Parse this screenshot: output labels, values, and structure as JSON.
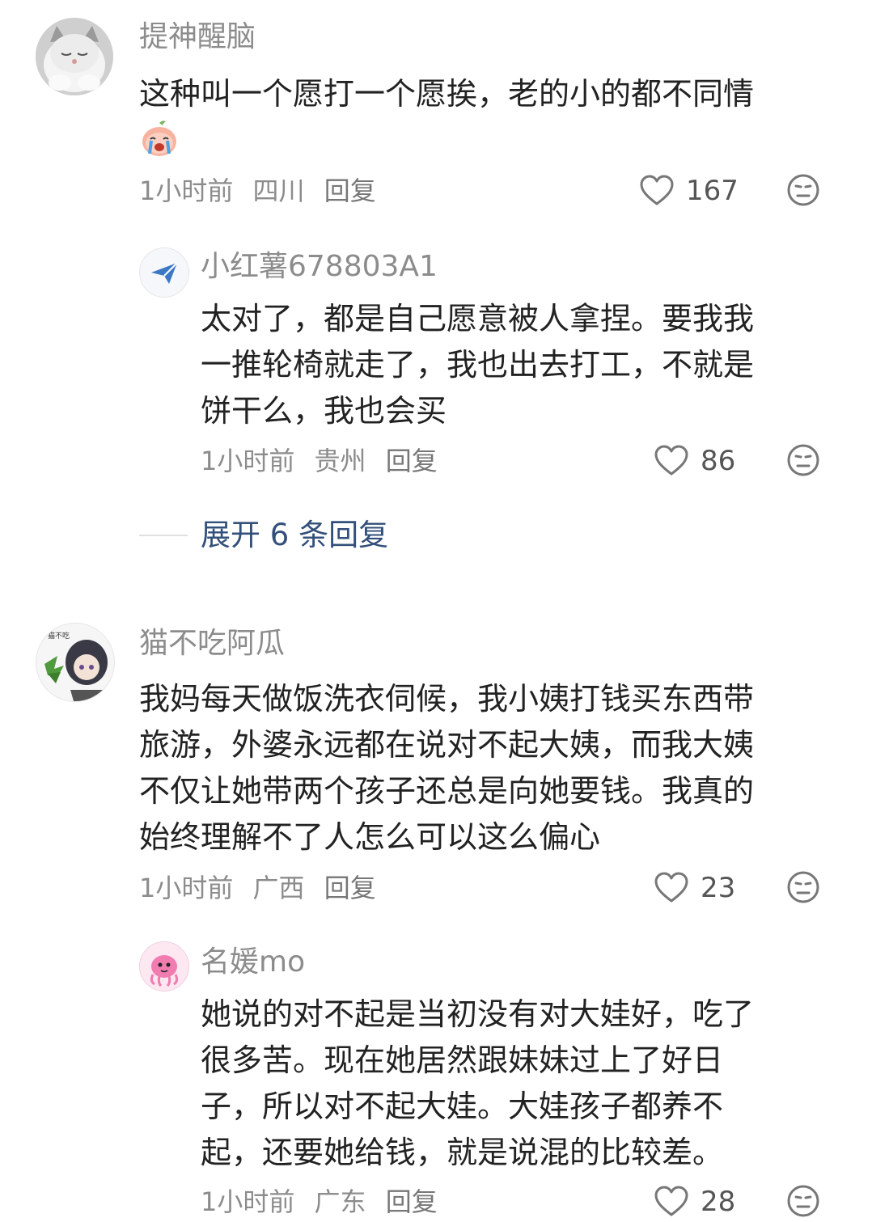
{
  "comments": [
    {
      "username": "提神醒脑",
      "lines": [
        "这种叫一个愿打一个愿挨，老的小的都不同情"
      ],
      "time": "1小时前",
      "region": "四川",
      "reply_label": "回复",
      "likes": "167",
      "emoji": "crying-peach-emoji"
    },
    {
      "username": "小红薯678803A1",
      "lines": [
        "太对了，都是自己愿意被人拿捏。要我我",
        "一推轮椅就走了，我也出去打工，不就是",
        "饼干么，我也会买"
      ],
      "time": "1小时前",
      "region": "贵州",
      "reply_label": "回复",
      "likes": "86"
    },
    {
      "username": "猫不吃阿瓜",
      "lines": [
        "我妈每天做饭洗衣伺候，我小姨打钱买东西带",
        "旅游，外婆永远都在说对不起大姨，而我大姨",
        "不仅让她带两个孩子还总是向她要钱。我真的",
        "始终理解不了人怎么可以这么偏心"
      ],
      "time": "1小时前",
      "region": "广西",
      "reply_label": "回复",
      "likes": "23"
    },
    {
      "username": "名媛mo",
      "lines": [
        "她说的对不起是当初没有对大娃好，吃了",
        "很多苦。现在她居然跟妹妹过上了好日",
        "子，所以对不起大娃。大娃孩子都养不",
        "起，还要她给钱，就是说混的比较差。"
      ],
      "time": "1小时前",
      "region": "广东",
      "reply_label": "回复",
      "likes": "28"
    }
  ],
  "expand_replies": "展开 6 条回复",
  "colors": {
    "meta": "#8c8c8c",
    "link": "#33507a",
    "text": "#222222"
  }
}
